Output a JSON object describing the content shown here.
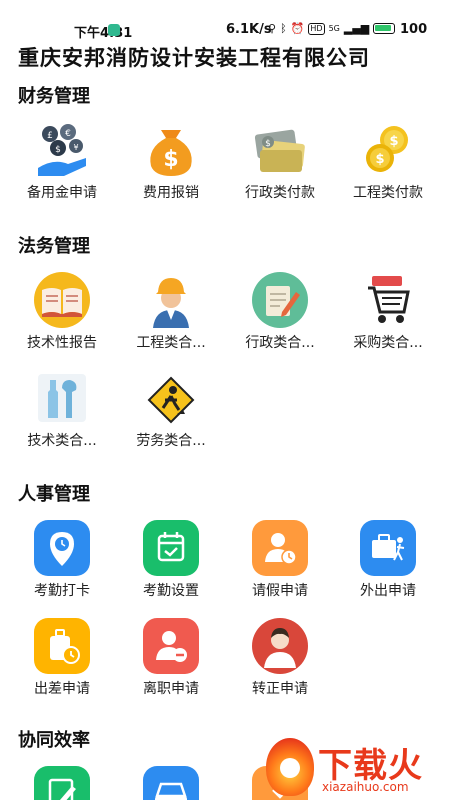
{
  "status_bar": {
    "time": "下午4:31",
    "speed": "6.1K/s",
    "signal": "5G",
    "hd": "HD",
    "battery": "100"
  },
  "company": "重庆安邦消防设计安装工程有限公司",
  "sections": [
    {
      "title": "财务管理",
      "items": [
        {
          "label": "备用金申请",
          "icon": "currency-exchange-icon"
        },
        {
          "label": "费用报销",
          "icon": "money-bag-icon"
        },
        {
          "label": "行政类付款",
          "icon": "cash-bills-icon"
        },
        {
          "label": "工程类付款",
          "icon": "gold-coins-icon"
        }
      ]
    },
    {
      "title": "法务管理",
      "items": [
        {
          "label": "技术性报告",
          "icon": "open-book-icon"
        },
        {
          "label": "工程类合...",
          "icon": "engineer-icon"
        },
        {
          "label": "行政类合...",
          "icon": "document-edit-icon"
        },
        {
          "label": "采购类合...",
          "icon": "shopping-cart-icon"
        },
        {
          "label": "技术类合...",
          "icon": "tools-icon"
        },
        {
          "label": "劳务类合...",
          "icon": "construction-sign-icon"
        }
      ]
    },
    {
      "title": "人事管理",
      "items": [
        {
          "label": "考勤打卡",
          "icon": "clock-pin-icon"
        },
        {
          "label": "考勤设置",
          "icon": "calendar-check-icon"
        },
        {
          "label": "请假申请",
          "icon": "person-clock-icon"
        },
        {
          "label": "外出申请",
          "icon": "briefcase-walk-icon"
        },
        {
          "label": "出差申请",
          "icon": "luggage-clock-icon"
        },
        {
          "label": "离职申请",
          "icon": "person-minus-icon"
        },
        {
          "label": "转正申请",
          "icon": "person-badge-icon"
        }
      ]
    },
    {
      "title": "协同效率",
      "items": [
        {
          "label": "",
          "icon": "edit-note-icon"
        },
        {
          "label": "",
          "icon": "car-icon"
        },
        {
          "label": "",
          "icon": "download-doc-icon"
        }
      ]
    }
  ],
  "watermark": {
    "text": "下载火",
    "url": "xiazaihuo.com"
  },
  "colors": {
    "blue": "#2d8cf0",
    "green": "#19be6b",
    "orange": "#ff9a3c",
    "red": "#f05a4f",
    "amber": "#ffb400",
    "brown": "#c0392b"
  }
}
